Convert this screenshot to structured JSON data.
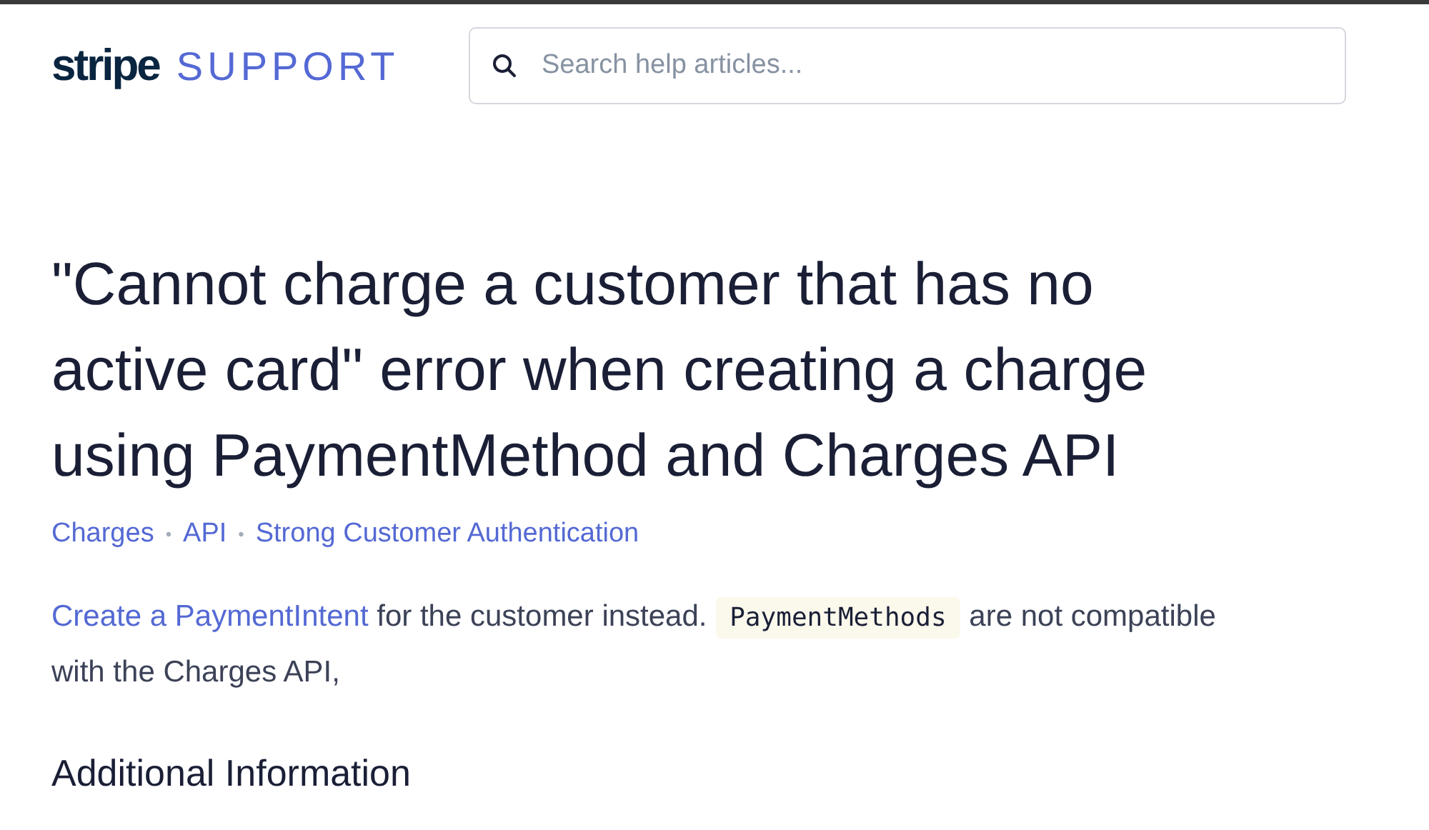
{
  "header": {
    "logo": "stripe",
    "section": "SUPPORT",
    "search": {
      "placeholder": "Search help articles..."
    }
  },
  "article": {
    "title": "\"Cannot charge a customer that has no active card\" error when creating a charge using PaymentMethod and Charges API",
    "tags": [
      "Charges",
      "API",
      "Strong Customer Authentication"
    ],
    "separator": "•",
    "body": [
      {
        "kind": "link",
        "text": "Create a PaymentIntent"
      },
      {
        "kind": "text",
        "text": " for the customer instead. "
      },
      {
        "kind": "code",
        "text": "PaymentMethods"
      },
      {
        "kind": "text",
        "text": " are not compatible with the Charges API,"
      }
    ],
    "next_heading": "Additional Information"
  }
}
